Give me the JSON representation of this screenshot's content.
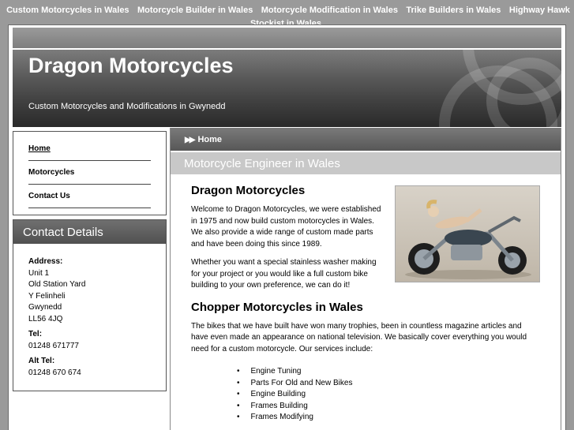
{
  "topnav": {
    "links": [
      "Custom Motorcycles in Wales",
      "Motorcycle Builder in Wales",
      "Motorcycle Modification in Wales",
      "Trike Builders in Wales",
      "Highway Hawk Stockist in Wales"
    ]
  },
  "header": {
    "title": "Dragon Motorcycles",
    "tagline": "Custom Motorcycles and Modifications in Gwynedd"
  },
  "menu": {
    "items": [
      "Home",
      "Motorcycles",
      "Contact Us"
    ]
  },
  "contact": {
    "heading": "Contact Details",
    "address_label": "Address:",
    "address_lines": [
      "Unit 1",
      "Old Station Yard",
      "Y Felinheli",
      "Gwynedd",
      "LL56 4JQ"
    ],
    "tel_label": "Tel:",
    "tel": "01248 671777",
    "alt_tel_label": "Alt Tel:",
    "alt_tel": "01248 670 674"
  },
  "main": {
    "breadcrumb": "Home",
    "section_title": "Motorcycle Engineer in Wales",
    "heading1": "Dragon Motorcycles",
    "para1": "Welcome to Dragon Motorcycles, we were established in 1975 and now build custom motorcycles in Wales. We also provide a wide range of custom made parts and have been doing this since 1989.",
    "para2": "Whether you want a special stainless washer making for your project or you would like a full custom bike building to your own preference, we can do it!",
    "heading2": "Chopper Motorcycles in Wales",
    "para3": "The bikes that we have built have won many trophies, been in countless magazine articles and have even made an appearance on national television. We basically cover everything you would need for a custom motorcycle. Our services include:",
    "services": [
      "Engine Tuning",
      "Parts For Old and New Bikes",
      "Engine Building",
      "Frames Building",
      "Frames Modifying"
    ]
  },
  "colors": {
    "page_bg": "#9a9a9a",
    "header_dark": "#2a2a2a",
    "accent_grey": "#c8c8c8"
  }
}
